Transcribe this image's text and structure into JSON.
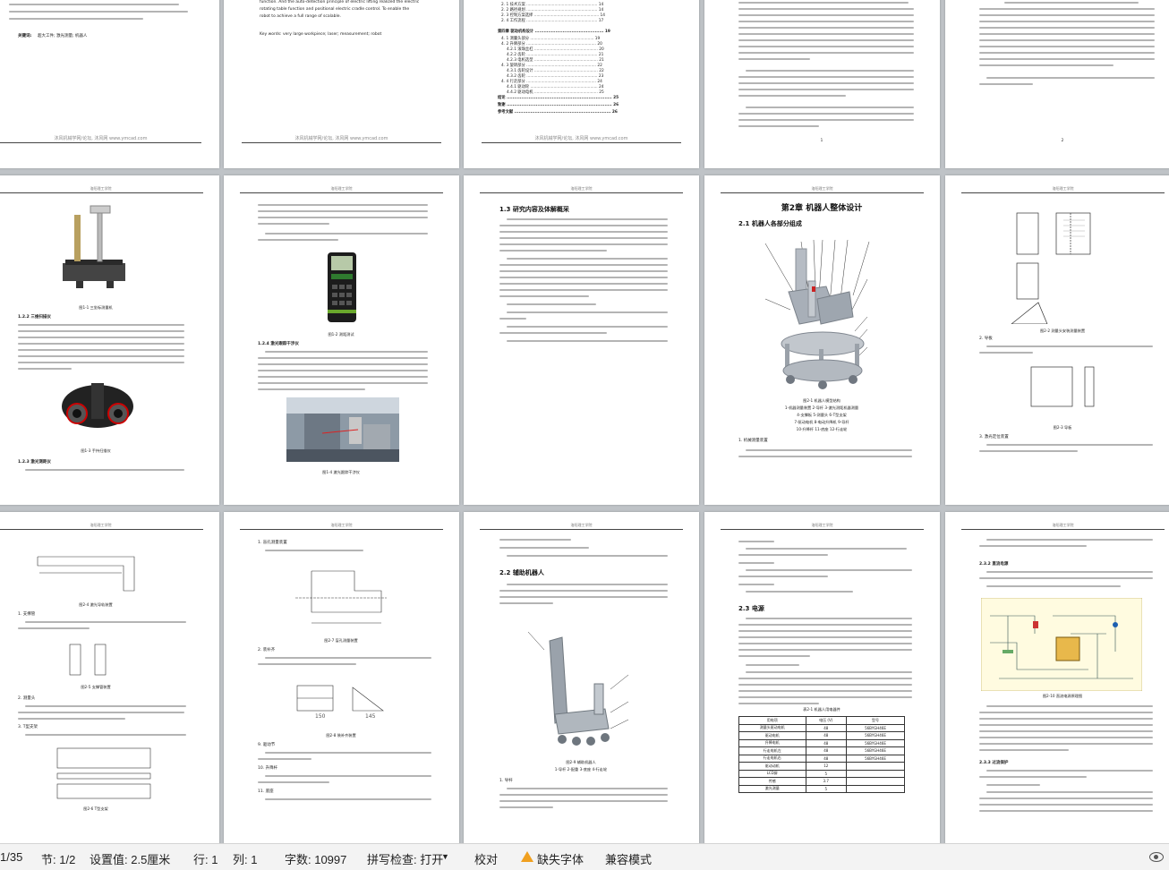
{
  "pages": {
    "p1": {
      "keywords_label": "关键词:",
      "keywords_value": "超大工件; 激光测量; 机器人",
      "footer": "沐风机械学网/论坛, 沐风网 www.ymcad.com"
    },
    "p2": {
      "abstract_lines": [
        "function. And the auto-detection principle of electric lifting realized the electric",
        "rotating table function and positional electric cradle control. To enable the",
        "robot to achieve a full range of scalable."
      ],
      "keywords": "Key words: very large workpiece; laser; measurement; robot",
      "footer": "沐风机械学网/论坛, 沐风网 www.ymcad.com"
    },
    "p3": {
      "toc": [
        "2. 1 技术方案 .......................................................... 14",
        "2. 2 路径规划 .......................................................... 14",
        "2. 3 控制方案选择 ..................................................... 14",
        "2. 4 工作流程 .......................................................... 17",
        "第四章 驱动机构设计 ............................................... 19",
        "4. 1 测量头部分 .................................................... 19",
        "4. 2 升降部分 ......................................................... 20",
        "4.2.1 滚珠丝杠 .................................................... 20",
        "4.2.2 齿轮 .......................................................... 21",
        "4.2.3 电机选型 .................................................... 21",
        "4. 3 旋转部分 ......................................................... 22",
        "4.3.1 齿轮设计 .................................................... 22",
        "4.3.2 齿轮 .......................................................... 23",
        "4. 4 行走部分 ......................................................... 24",
        "4.4.1 驱动轮 ....................................................... 24",
        "4.4.2 驱动电机 .................................................... 25",
        "结论 ........................................................................ 25",
        "致谢 ........................................................................ 26",
        "参考文献 .................................................................. 26"
      ],
      "footer": "沐风机械学网/论坛, 沐风网 www.ymcad.com"
    },
    "p7": {
      "caption_a": "图1-2 测距测试",
      "caption_b": "图1-4 激光跟踪干涉仪",
      "sub": "1.2.4 激光跟踪干涉仪"
    },
    "p6": {
      "caption_a": "图1-1 三坐标测量机",
      "caption_b": "图1-3 手持扫描仪",
      "sub_a": "1.2.2 三维扫描仪",
      "sub_b": "1.2.3 激光测距仪"
    },
    "p8": {
      "section": "1.3 研究内容及体解概采"
    },
    "p9": {
      "chapter": "第2章 机器人整体设计",
      "section": "2.1 机器人各部分组成",
      "caption": "图2-1 机器人模型结构",
      "legend": [
        "1-机器测量装置 2-导杆 3-激光测距机器测量",
        "4-支撑板 5-测量头 6-T型支架",
        "7-驱动电机 8-电动升降机 9-导杆",
        "10-升降杆 11-底座 12-行走轮"
      ],
      "item": "1. 机械测量装置"
    },
    "p10": {
      "caption_a": "图2-2 测量头安装测量装置",
      "item_2": "2. 导板",
      "caption_b": "图2-3 导板",
      "item_3": "3. 激光定位装置"
    },
    "p11": {
      "caption_a": "图2-4 激光导轨装置",
      "item_1": "1. 支撑管",
      "caption_b": "图2-5 支撑管装置",
      "item_2": "2. 测量头",
      "item_3": "3. T型支架",
      "caption_c": "图2-6 T型支架"
    },
    "p12": {
      "item_1": "1. 盲孔测量装置",
      "caption_a": "图2-7 盲孔测量装置",
      "item_2": "2. 装补齐",
      "caption_b": "图2-8 装补齐装置",
      "dim_1": "150",
      "dim_2": "145",
      "item_9": "9. 驱动节",
      "item_10": "10. 升降杆",
      "item_11": "11. 底座"
    },
    "p13": {
      "section": "2.2 辅助机器人",
      "caption": "图2-9 辅助机器人",
      "legend": "1-导杆 2-配重 3-底座 4-行走轮",
      "item": "1. 导杆"
    },
    "p14": {
      "section": "2.3 电源",
      "table_title": "表2-1 机器人用电器件",
      "table_header": [
        "用电项",
        "电压 (V)",
        "型号"
      ],
      "table_rows": [
        [
          "测量头驱动电机",
          "48",
          "56BYGH46E"
        ],
        [
          "驱动电机",
          "48",
          "56BYGH46E"
        ],
        [
          "升降电机",
          "48",
          "56BYGH46E"
        ],
        [
          "行走电机左",
          "48",
          "56BYGH46E"
        ],
        [
          "行走电机右",
          "48",
          "56BYGH46E"
        ],
        [
          "驱动动机",
          "12",
          ""
        ],
        [
          "LCD屏",
          "5",
          ""
        ],
        [
          "传感",
          "3.7",
          ""
        ],
        [
          "激光测量",
          "5",
          ""
        ]
      ]
    },
    "p15": {
      "sub_a": "2.3.2 直流电源",
      "caption": "图2-10 直流电源原理图",
      "sub_b": "2.3.3 过流保护"
    },
    "p4": {
      "footer": "1"
    },
    "p5": {
      "footer": "2"
    }
  },
  "statusbar": {
    "page": "1/35",
    "section": "节: 1/2",
    "position": "设置值: 2.5厘米",
    "line": "行: 1",
    "column": "列: 1",
    "word_count": "字数: 10997",
    "spell_check": "拼写检查: 打开",
    "proofread": "校对",
    "missing_font": "缺失字体",
    "compat_mode": "兼容模式"
  }
}
